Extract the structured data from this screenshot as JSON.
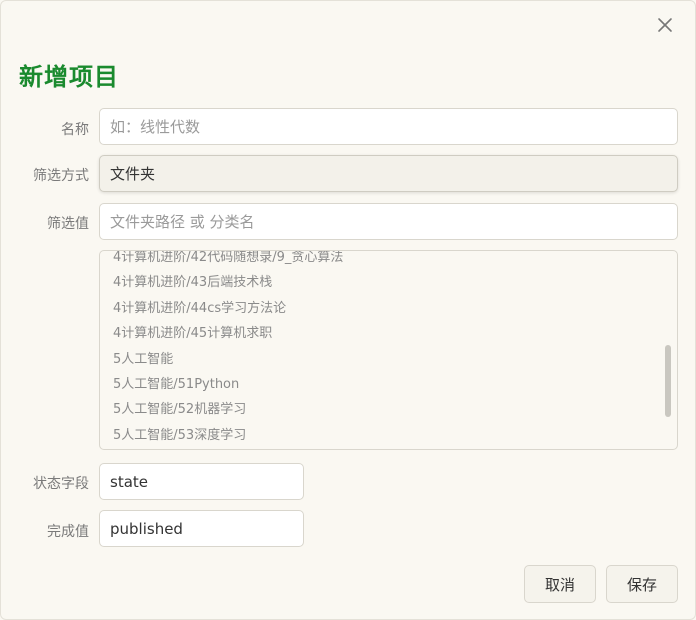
{
  "dialog": {
    "title": "新增项目",
    "close_icon": "close-icon"
  },
  "form": {
    "name": {
      "label": "名称",
      "placeholder": "如：线性代数",
      "value": ""
    },
    "filter_mode": {
      "label": "筛选方式",
      "value": "文件夹"
    },
    "filter_value": {
      "label": "筛选值",
      "placeholder": "文件夹路径 或 分类名",
      "value": ""
    },
    "options": [
      "4计算机进阶/42代码随想录/9_贪心算法",
      "4计算机进阶/43后端技术栈",
      "4计算机进阶/44cs学习方法论",
      "4计算机进阶/45计算机求职",
      "5人工智能",
      "5人工智能/51Python",
      "5人工智能/52机器学习",
      "5人工智能/53深度学习"
    ],
    "state_field": {
      "label": "状态字段",
      "value": "state"
    },
    "done_value": {
      "label": "完成值",
      "value": "published"
    }
  },
  "buttons": {
    "cancel": "取消",
    "save": "保存"
  },
  "colors": {
    "title": "#1a8a2e",
    "background": "#faf8f2"
  }
}
